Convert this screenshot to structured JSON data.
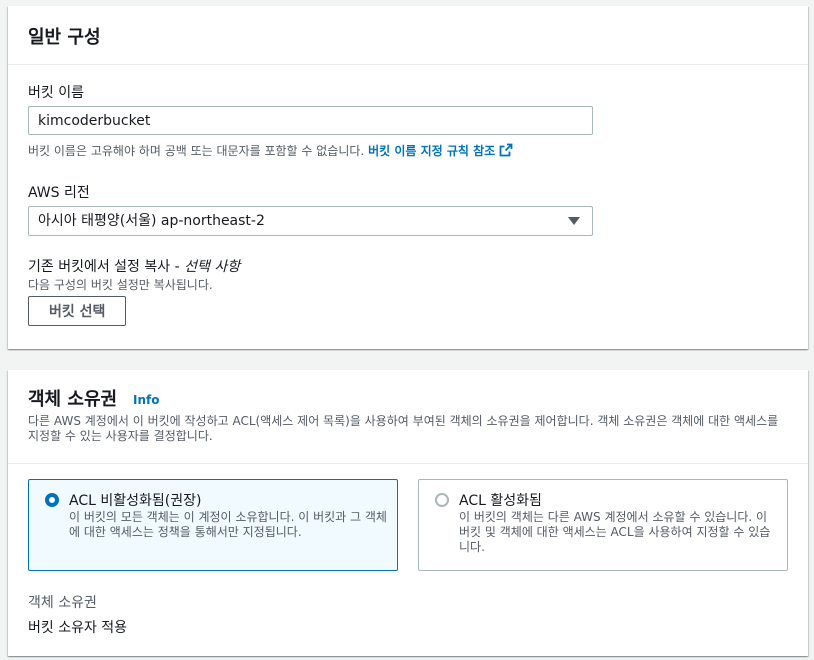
{
  "general": {
    "title": "일반 구성",
    "bucket_name_label": "버킷 이름",
    "bucket_name_value": "kimcoderbucket",
    "bucket_name_hint": "버킷 이름은 고유해야 하며 공백 또는 대문자를 포함할 수 없습니다.",
    "bucket_name_rules_link": "버킷 이름 지정 규칙 참조",
    "region_label": "AWS 리전",
    "region_value": "아시아 태평양(서울) ap-northeast-2",
    "copy_label": "기존 버킷에서 설정 복사 - ",
    "copy_label_optional": "선택 사항",
    "copy_desc": "다음 구성의 버킷 설정만 복사됩니다.",
    "choose_bucket_button": "버킷 선택"
  },
  "ownership": {
    "title": "객체 소유권",
    "info_link": "Info",
    "description": "다른 AWS 계정에서 이 버킷에 작성하고 ACL(액세스 제어 목록)을 사용하여 부여된 객체의 소유권을 제어합니다. 객체 소유권은 객체에 대한 액세스를 지정할 수 있는 사용자를 결정합니다.",
    "options": [
      {
        "title": "ACL 비활성화됨(권장)",
        "desc": "이 버킷의 모든 객체는 이 계정이 소유합니다. 이 버킷과 그 객체에 대한 액세스는 정책을 통해서만 지정됩니다.",
        "selected": true
      },
      {
        "title": "ACL 활성화됨",
        "desc": "이 버킷의 객체는 다른 AWS 계정에서 소유할 수 있습니다. 이 버킷 및 객체에 대한 액세스는 ACL을 사용하여 지정할 수 있습니다.",
        "selected": false
      }
    ],
    "result_label": "객체 소유권",
    "result_value": "버킷 소유자 적용"
  },
  "colors": {
    "link": "#0073bb",
    "selected_bg": "#f1faff",
    "text": "#16191f",
    "secondary_text": "#545b64"
  }
}
